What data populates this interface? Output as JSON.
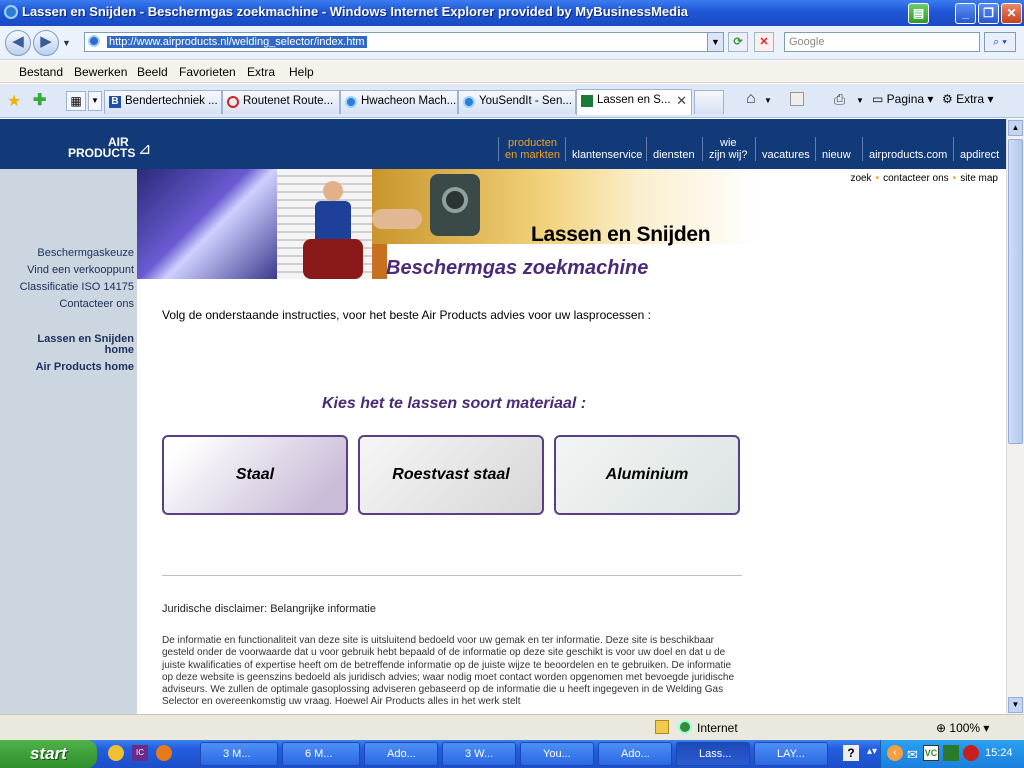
{
  "window": {
    "title": "Lassen en Snijden - Beschermgas zoekmachine - Windows Internet Explorer provided by MyBusinessMedia"
  },
  "addressbar": {
    "url": "http://www.airproducts.nl/welding_selector/index.htm",
    "search_placeholder": "Google"
  },
  "menubar": {
    "items": [
      "Bestand",
      "Bewerken",
      "Beeld",
      "Favorieten",
      "Extra",
      "Help"
    ]
  },
  "tabs": {
    "items": [
      "Bendertechniek ...",
      "Routenet Route...",
      "Hwacheon Mach...",
      "YouSendIt - Sen...",
      "Lassen en S..."
    ],
    "active_index": 4
  },
  "toolbar": {
    "pagina": "Pagina",
    "extra": "Extra"
  },
  "site": {
    "logo_line1": "AIR",
    "logo_line2": "PRODUCTS",
    "topnav": [
      {
        "l1": "producten",
        "l2": "en markten"
      },
      {
        "l1": "",
        "l2": "klantenservice"
      },
      {
        "l1": "",
        "l2": "diensten"
      },
      {
        "l1": "wie",
        "l2": "zijn wij?"
      },
      {
        "l1": "",
        "l2": "vacatures"
      },
      {
        "l1": "",
        "l2": "nieuw"
      },
      {
        "l1": "",
        "l2": "airproducts.com"
      },
      {
        "l1": "",
        "l2": "apdirect"
      }
    ],
    "utilnav": [
      "zoek",
      "contacteer ons",
      "site map"
    ],
    "leftnav": [
      "Beschermgaskeuze",
      "Vind een verkooppunt",
      "Classificatie ISO 14175",
      "Contacteer ons"
    ],
    "leftnav_bold": [
      "Lassen en Snijden home",
      "Air Products home"
    ],
    "heading": "Lassen en Snijden",
    "subheading": "Beschermgas zoekmachine",
    "intro": "Volg de onderstaande instructies, voor het beste Air Products advies voor uw lasprocessen :",
    "choose": "Kies het te lassen soort materiaal :",
    "materials": [
      "Staal",
      "Roestvast staal",
      "Aluminium"
    ],
    "disclaimer_title": "Juridische disclaimer: Belangrijke informatie",
    "disclaimer_text": "De informatie en functionaliteit van deze site is uitsluitend bedoeld voor uw gemak en ter informatie. Deze site is beschikbaar gesteld onder de voorwaarde dat u voor gebruik hebt bepaald of de informatie op deze site geschikt is voor uw doel en dat u de juiste kwalificaties of expertise heeft om de betreffende informatie op de juiste wijze te beoordelen en te gebruiken. De informatie op deze website is geenszins bedoeld als juridisch advies; waar nodig moet contact worden opgenomen met bevoegde juridische adviseurs. We zullen de optimale gasoplossing adviseren gebaseerd op de informatie die u heeft ingegeven in de Welding Gas Selector en overeenkomstig uw vraag. Hoewel Air Products alles in het werk stelt"
  },
  "statusbar": {
    "zone": "Internet",
    "zoom": "100%"
  },
  "taskbar": {
    "start": "start",
    "tasks": [
      "3 M...",
      "6 M...",
      "Ado...",
      "3 W...",
      "You...",
      "Ado...",
      "Lass...",
      "LAY..."
    ],
    "active_index": 6,
    "clock": "15:24"
  }
}
